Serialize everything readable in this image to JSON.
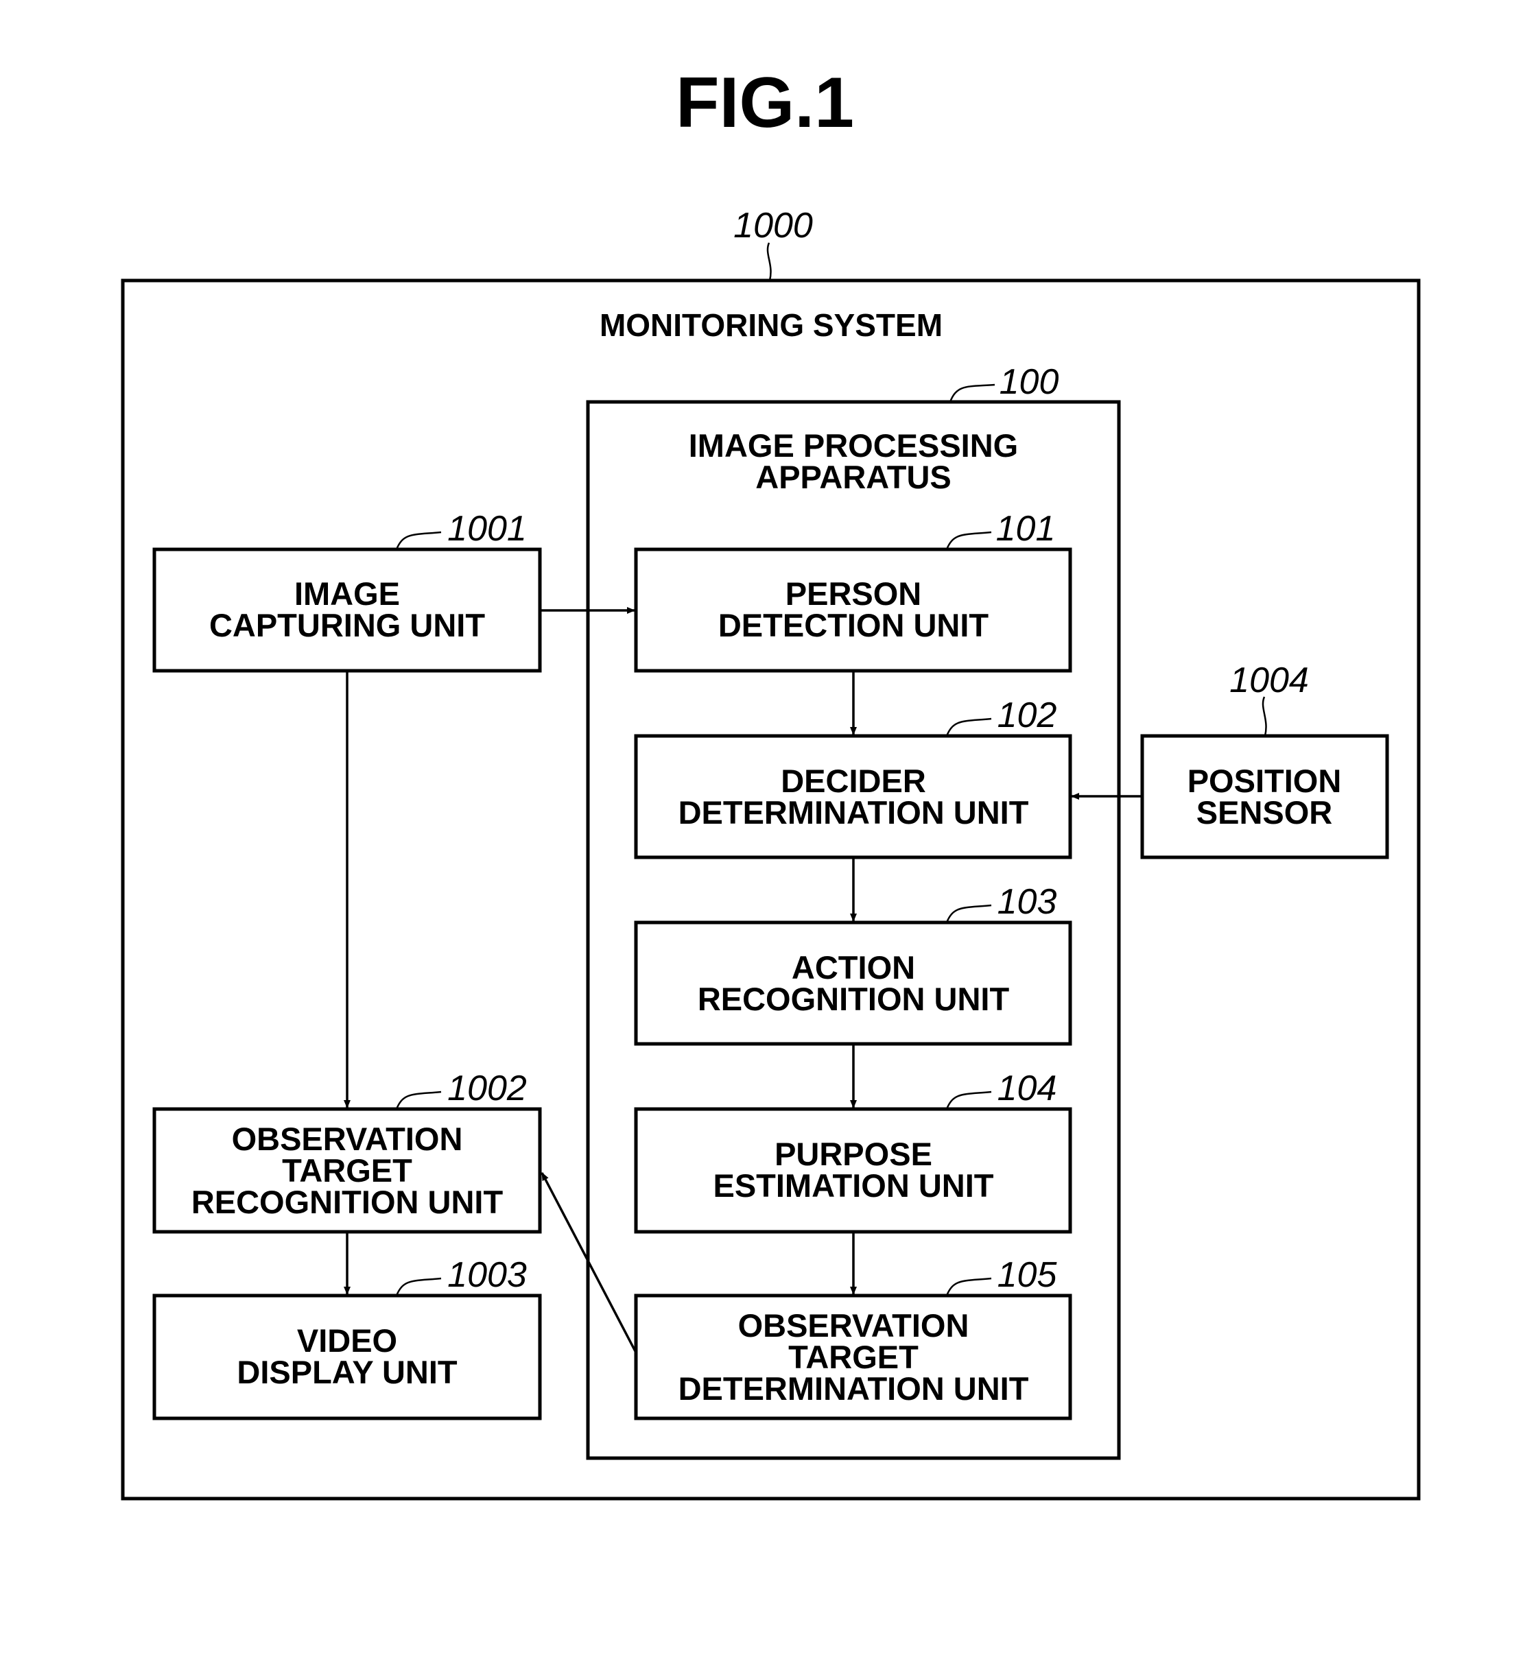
{
  "figure": {
    "title": "FIG.1"
  },
  "system": {
    "ref": "1000",
    "title": "MONITORING SYSTEM"
  },
  "apparatus": {
    "ref": "100",
    "title_lines": [
      "IMAGE PROCESSING",
      "APPARATUS"
    ]
  },
  "blocks": {
    "image_capturing": {
      "ref": "1001",
      "lines": [
        "IMAGE",
        "CAPTURING UNIT"
      ]
    },
    "observation_target_recognition": {
      "ref": "1002",
      "lines": [
        "OBSERVATION",
        "TARGET",
        "RECOGNITION UNIT"
      ]
    },
    "video_display": {
      "ref": "1003",
      "lines": [
        "VIDEO",
        "DISPLAY UNIT"
      ]
    },
    "position_sensor": {
      "ref": "1004",
      "lines": [
        "POSITION",
        "SENSOR"
      ]
    },
    "person_detection": {
      "ref": "101",
      "lines": [
        "PERSON",
        "DETECTION UNIT"
      ]
    },
    "decider_determination": {
      "ref": "102",
      "lines": [
        "DECIDER",
        "DETERMINATION UNIT"
      ]
    },
    "action_recognition": {
      "ref": "103",
      "lines": [
        "ACTION",
        "RECOGNITION UNIT"
      ]
    },
    "purpose_estimation": {
      "ref": "104",
      "lines": [
        "PURPOSE",
        "ESTIMATION UNIT"
      ]
    },
    "observation_target_determination": {
      "ref": "105",
      "lines": [
        "OBSERVATION",
        "TARGET",
        "DETERMINATION UNIT"
      ]
    }
  },
  "connections": [
    {
      "from": "image_capturing",
      "to": "person_detection"
    },
    {
      "from": "image_capturing",
      "to": "observation_target_recognition"
    },
    {
      "from": "person_detection",
      "to": "decider_determination"
    },
    {
      "from": "position_sensor",
      "to": "decider_determination"
    },
    {
      "from": "decider_determination",
      "to": "action_recognition"
    },
    {
      "from": "action_recognition",
      "to": "purpose_estimation"
    },
    {
      "from": "purpose_estimation",
      "to": "observation_target_determination"
    },
    {
      "from": "observation_target_determination",
      "to": "observation_target_recognition"
    },
    {
      "from": "observation_target_recognition",
      "to": "video_display"
    }
  ]
}
